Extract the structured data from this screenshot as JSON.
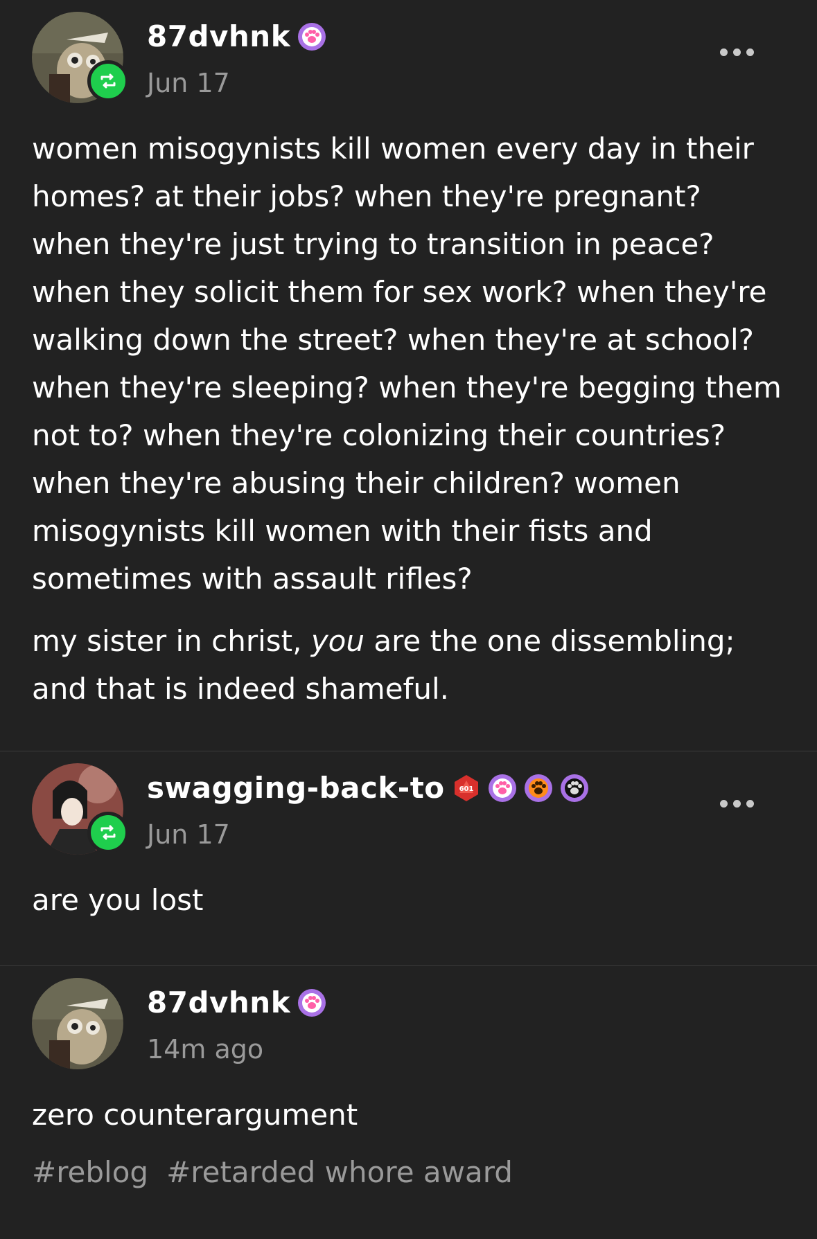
{
  "posts": [
    {
      "username": "87dvhnk",
      "date": "Jun 17",
      "badges": [
        "purple-paw-badge"
      ],
      "reblogged": true,
      "paragraphs": [
        "women misogynists kill women every day in their homes? at their jobs? when they're pregnant? when they're just trying to transition in peace? when they solicit them for sex work? when they're walking down the street? when they're at school? when they're sleeping? when they're begging them not to? when they're colonizing their countries? when they're abusing their children? women misogynists kill women with their fists and sometimes with assault rifles?"
      ],
      "p2_before": "my sister in christ, ",
      "p2_em": "you",
      "p2_after": " are the one dissembling; and that is indeed shameful."
    },
    {
      "username": "swagging-back-to",
      "date": "Jun 17",
      "badges": [
        "red-d20-badge",
        "purple-paw-badge",
        "orange-paw-badge",
        "black-paw-badge"
      ],
      "badge_d20_text": "601",
      "reblogged": true,
      "text": "are you lost"
    },
    {
      "username": "87dvhnk",
      "date": "14m ago",
      "badges": [
        "purple-paw-badge"
      ],
      "reblogged": false,
      "text": "zero counterargument",
      "tags": [
        "#reblog",
        "#retarded whore award"
      ]
    }
  ],
  "colors": {
    "background": "#222222",
    "reblog_green": "#1fce4d",
    "muted_text": "#9a9a9a",
    "divider": "#3a3a3a"
  }
}
